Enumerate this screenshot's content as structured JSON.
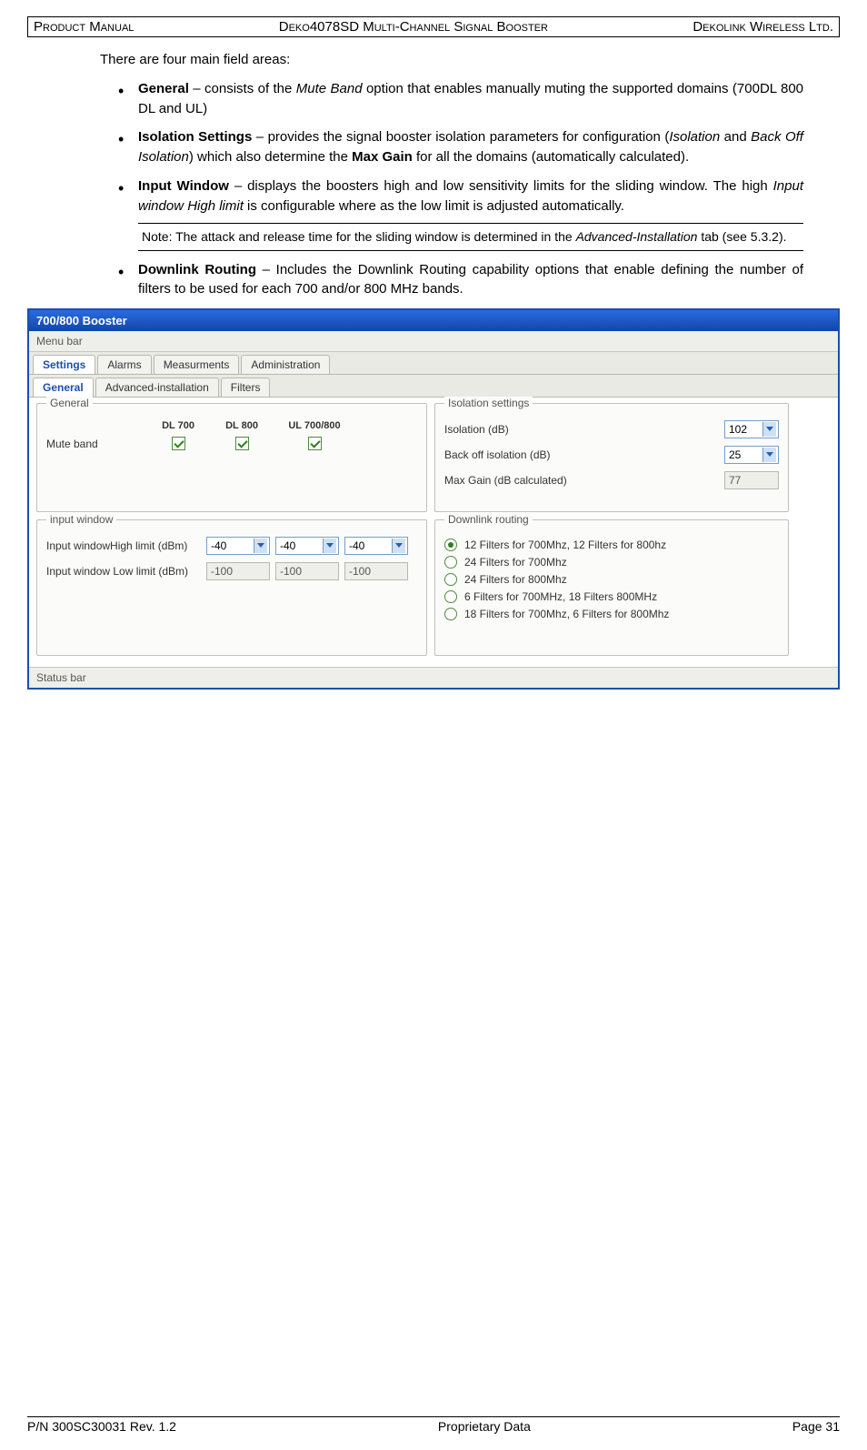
{
  "header": {
    "left": "Product Manual",
    "center": "Deko4078SD Multi-Channel Signal Booster",
    "right": "Dekolink Wireless Ltd."
  },
  "body": {
    "intro": "There are four main field areas:",
    "b1_bold": "General",
    "b1_rest_a": " – consists of the ",
    "b1_it": "Mute Band",
    "b1_rest_b": " option that enables manually muting the supported domains (700DL  800 DL and UL)",
    "b2_bold": "Isolation Settings",
    "b2_rest_a": " – provides the signal booster isolation parameters for configuration (",
    "b2_it1": "Isolation",
    "b2_and": " and ",
    "b2_it2": "Back Off Isolation",
    "b2_rest_b": ") which also determine the ",
    "b2_bold2": "Max Gain",
    "b2_rest_c": " for all the domains (automatically calculated).",
    "b3_bold": "Input Window",
    "b3_rest_a": " – displays the boosters high and low sensitivity limits for the sliding window. The high ",
    "b3_it": "Input window High limit",
    "b3_rest_b": " is configurable where as the low limit is adjusted automatically.",
    "note_a": "Note: The attack and release time for the sliding window is determined in the ",
    "note_it": "Advanced-Installation",
    "note_b": " tab (see  5.3.2).",
    "b4_bold": "Downlink Routing",
    "b4_rest": " – Includes the Downlink Routing capability options that enable defining the number of filters to be used for each 700 and/or 800 MHz bands."
  },
  "app": {
    "title": "700/800 Booster",
    "menu_bar": "Menu bar",
    "status_bar": "Status bar",
    "tabs1": {
      "settings": "Settings",
      "alarms": "Alarms",
      "meas": "Measurments",
      "admin": "Administration"
    },
    "tabs2": {
      "general": "General",
      "advinst": "Advanced-installation",
      "filters": "Filters"
    },
    "general": {
      "legend": "General",
      "mute_band": "Mute band",
      "dl700": "DL 700",
      "dl800": "DL 800",
      "ul700800": "UL 700/800"
    },
    "isolation": {
      "legend": "Isolation settings",
      "iso_lbl": "Isolation (dB)",
      "back_lbl": "Back off isolation (dB)",
      "max_lbl": "Max Gain (dB calculated)",
      "iso_val": "102",
      "back_val": "25",
      "max_val": "77"
    },
    "inputwin": {
      "legend": "input window",
      "high_lbl": "Input windowHigh limit (dBm)",
      "low_lbl": "Input window Low limit (dBm)",
      "high1": "-40",
      "high2": "-40",
      "high3": "-40",
      "low1": "-100",
      "low2": "-100",
      "low3": "-100"
    },
    "routing": {
      "legend": "Downlink routing",
      "r1": "12  Filters for 700Mhz,  12 Filters for 800hz",
      "r2": "24  Filters for 700Mhz",
      "r3": "24  Filters for 800Mhz",
      "r4": "6    Filters for 700MHz, 18 Filters 800MHz",
      "r5": "18  Filters for 700Mhz,  6 Filters for 800Mhz"
    }
  },
  "footer": {
    "left": "P/N 300SC30031 Rev. 1.2",
    "center": "Proprietary Data",
    "right": "Page 31"
  }
}
